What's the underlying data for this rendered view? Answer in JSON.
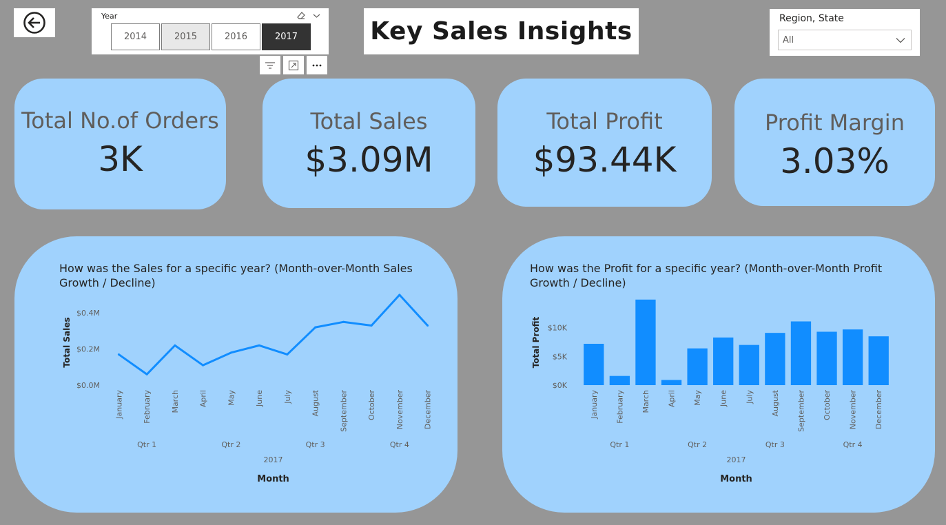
{
  "header": {
    "title": "Key Sales Insights",
    "back_icon": "back-arrow-icon"
  },
  "year_slicer": {
    "label": "Year",
    "options": [
      "2014",
      "2015",
      "2016",
      "2017"
    ],
    "selected": "2017",
    "hovered": "2015"
  },
  "region_slicer": {
    "label": "Region, State",
    "value": "All"
  },
  "kpis": {
    "orders": {
      "label": "Total No.of Orders",
      "value": "3K"
    },
    "sales": {
      "label": "Total Sales",
      "value": "$3.09M"
    },
    "profit": {
      "label": "Total Profit",
      "value": "$93.44K"
    },
    "margin": {
      "label": "Profit Margin",
      "value": "3.03%"
    }
  },
  "chart_data": [
    {
      "type": "line",
      "title": "How was the Sales for a specific year? (Month-over-Month Sales Growth / Decline)",
      "xlabel": "Month",
      "ylabel": "Total Sales",
      "year_label": "2017",
      "quarters": [
        "Qtr 1",
        "Qtr 2",
        "Qtr 3",
        "Qtr 4"
      ],
      "categories": [
        "January",
        "February",
        "March",
        "April",
        "May",
        "June",
        "July",
        "August",
        "September",
        "October",
        "November",
        "December"
      ],
      "values": [
        0.17,
        0.06,
        0.22,
        0.11,
        0.18,
        0.22,
        0.17,
        0.32,
        0.35,
        0.33,
        0.5,
        0.33
      ],
      "y_ticks": [
        {
          "v": 0,
          "label": "$0.0M"
        },
        {
          "v": 0.2,
          "label": "$0.2M"
        },
        {
          "v": 0.4,
          "label": "$0.4M"
        }
      ],
      "ylim": [
        0,
        0.5
      ],
      "color": "#118dff"
    },
    {
      "type": "bar",
      "title": "How was the Profit for a specific year? (Month-over-Month Profit Growth / Decline)",
      "xlabel": "Month",
      "ylabel": "Total Profit",
      "year_label": "2017",
      "quarters": [
        "Qtr 1",
        "Qtr 2",
        "Qtr 3",
        "Qtr 4"
      ],
      "categories": [
        "January",
        "February",
        "March",
        "April",
        "May",
        "June",
        "July",
        "August",
        "September",
        "October",
        "November",
        "December"
      ],
      "values": [
        7200,
        1600,
        14900,
        900,
        6400,
        8300,
        7000,
        9100,
        11100,
        9300,
        9700,
        8500
      ],
      "y_ticks": [
        {
          "v": 0,
          "label": "$0K"
        },
        {
          "v": 5000,
          "label": "$5K"
        },
        {
          "v": 10000,
          "label": "$10K"
        }
      ],
      "ylim": [
        0,
        15000
      ],
      "color": "#118dff"
    }
  ]
}
